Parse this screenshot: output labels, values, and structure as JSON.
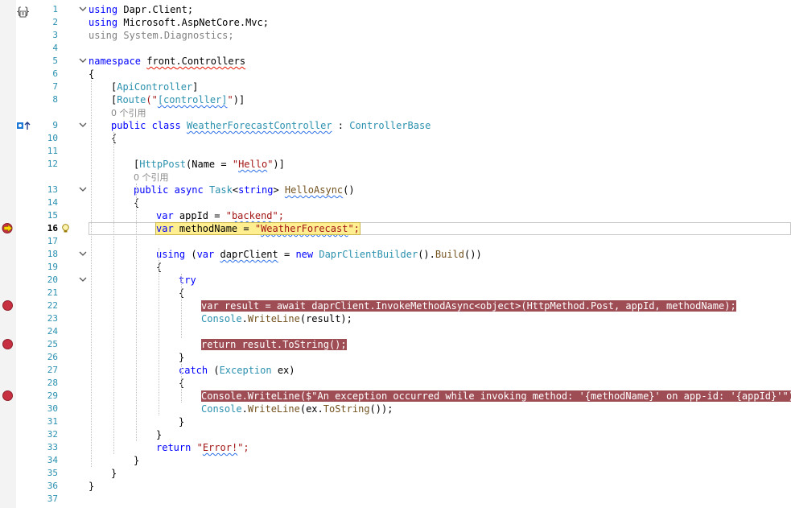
{
  "editor": {
    "lines": [
      {
        "n": "1",
        "fold": "open",
        "tokens": [
          {
            "t": "using",
            "c": "kw"
          },
          {
            "t": " Dapr.Client;",
            "c": "pl"
          }
        ]
      },
      {
        "n": "2",
        "tokens": [
          {
            "t": "using",
            "c": "kw"
          },
          {
            "t": " Microsoft.AspNetCore.Mvc;",
            "c": "pl"
          }
        ]
      },
      {
        "n": "3",
        "tokens": [
          {
            "t": "using System.Diagnostics;",
            "c": "cm"
          }
        ]
      },
      {
        "n": "4",
        "tokens": []
      },
      {
        "n": "5",
        "fold": "open",
        "tokens": [
          {
            "t": "namespace",
            "c": "kw"
          },
          {
            "t": " ",
            "c": "pl"
          },
          {
            "t": "front",
            "c": "pl",
            "s": "squig-red"
          },
          {
            "t": ".Controllers",
            "c": "pl",
            "s": "squig-red"
          }
        ]
      },
      {
        "n": "6",
        "tokens": [
          {
            "t": "{",
            "c": "pl"
          }
        ]
      },
      {
        "n": "7",
        "indent": 1,
        "tokens": [
          {
            "t": "[",
            "c": "pl"
          },
          {
            "t": "ApiController",
            "c": "ty"
          },
          {
            "t": "]",
            "c": "pl"
          }
        ]
      },
      {
        "n": "8",
        "indent": 1,
        "tokens": [
          {
            "t": "[",
            "c": "pl"
          },
          {
            "t": "Route",
            "c": "ty"
          },
          {
            "t": "(\"",
            "c": "st"
          },
          {
            "t": "[controller]",
            "c": "ty",
            "s": "squig"
          },
          {
            "t": "\"",
            "c": "st"
          },
          {
            "t": ")]",
            "c": "pl"
          }
        ]
      },
      {
        "n": "",
        "indent": 1,
        "lens": "0 个引用"
      },
      {
        "n": "9",
        "fold": "open",
        "indent": 1,
        "tokens": [
          {
            "t": "public",
            "c": "kw"
          },
          {
            "t": " ",
            "c": "pl"
          },
          {
            "t": "class",
            "c": "kw"
          },
          {
            "t": " ",
            "c": "pl"
          },
          {
            "t": "WeatherForecastController",
            "c": "ty",
            "s": "squig"
          },
          {
            "t": " : ",
            "c": "pl"
          },
          {
            "t": "ControllerBase",
            "c": "ty"
          }
        ]
      },
      {
        "n": "10",
        "indent": 1,
        "tokens": [
          {
            "t": "{",
            "c": "pl"
          }
        ]
      },
      {
        "n": "11",
        "tokens": []
      },
      {
        "n": "12",
        "indent": 2,
        "tokens": [
          {
            "t": "[",
            "c": "pl"
          },
          {
            "t": "HttpPost",
            "c": "ty"
          },
          {
            "t": "(Name = ",
            "c": "pl"
          },
          {
            "t": "\"",
            "c": "st"
          },
          {
            "t": "Hello",
            "c": "st",
            "s": "squig"
          },
          {
            "t": "\"",
            "c": "st"
          },
          {
            "t": ")]",
            "c": "pl"
          }
        ]
      },
      {
        "n": "",
        "indent": 2,
        "lens": "0 个引用"
      },
      {
        "n": "13",
        "fold": "open",
        "indent": 2,
        "tokens": [
          {
            "t": "public",
            "c": "kw"
          },
          {
            "t": " ",
            "c": "pl"
          },
          {
            "t": "async",
            "c": "kw"
          },
          {
            "t": " ",
            "c": "pl"
          },
          {
            "t": "Task",
            "c": "ty"
          },
          {
            "t": "<",
            "c": "pl"
          },
          {
            "t": "string",
            "c": "kw"
          },
          {
            "t": "> ",
            "c": "pl"
          },
          {
            "t": "HelloAsync",
            "c": "meth",
            "s": "squig"
          },
          {
            "t": "()",
            "c": "pl"
          }
        ]
      },
      {
        "n": "14",
        "indent": 2,
        "tokens": [
          {
            "t": "{",
            "c": "pl"
          }
        ]
      },
      {
        "n": "15",
        "indent": 3,
        "tokens": [
          {
            "t": "var",
            "c": "kw"
          },
          {
            "t": " appId = ",
            "c": "pl"
          },
          {
            "t": "\"",
            "c": "st"
          },
          {
            "t": "backend",
            "c": "st",
            "s": "squig"
          },
          {
            "t": "\";",
            "c": "st"
          }
        ]
      },
      {
        "n": "16",
        "indent": 3,
        "current": true,
        "tokens": [
          {
            "t": "var",
            "c": "kw"
          },
          {
            "t": " methodName = ",
            "c": "pl"
          },
          {
            "t": "\"",
            "c": "st"
          },
          {
            "t": "WeatherForecast",
            "c": "st",
            "s": "squig"
          },
          {
            "t": "\";",
            "c": "st"
          }
        ]
      },
      {
        "n": "17",
        "tokens": []
      },
      {
        "n": "18",
        "fold": "open",
        "indent": 3,
        "tokens": [
          {
            "t": "using",
            "c": "kw"
          },
          {
            "t": " (",
            "c": "pl"
          },
          {
            "t": "var",
            "c": "kw"
          },
          {
            "t": " ",
            "c": "pl"
          },
          {
            "t": "daprClient",
            "c": "pl",
            "s": "squig"
          },
          {
            "t": " = ",
            "c": "pl"
          },
          {
            "t": "new",
            "c": "kw"
          },
          {
            "t": " ",
            "c": "pl"
          },
          {
            "t": "DaprClientBuilder",
            "c": "ty"
          },
          {
            "t": "().",
            "c": "pl"
          },
          {
            "t": "Build",
            "c": "meth"
          },
          {
            "t": "())",
            "c": "pl"
          }
        ]
      },
      {
        "n": "19",
        "indent": 3,
        "tokens": [
          {
            "t": "{",
            "c": "pl"
          }
        ]
      },
      {
        "n": "20",
        "fold": "open",
        "indent": 4,
        "tokens": [
          {
            "t": "try",
            "c": "kw"
          }
        ]
      },
      {
        "n": "21",
        "indent": 4,
        "tokens": [
          {
            "t": "{",
            "c": "pl"
          }
        ]
      },
      {
        "n": "22",
        "indent": 5,
        "bp": true,
        "tokens": [
          {
            "t": "var result = await daprClient.InvokeMethodAsync<object>(HttpMethod.Post, appId, methodName);",
            "c": "pl"
          }
        ]
      },
      {
        "n": "23",
        "indent": 5,
        "tokens": [
          {
            "t": "Console",
            "c": "ty"
          },
          {
            "t": ".",
            "c": "pl"
          },
          {
            "t": "WriteLine",
            "c": "meth"
          },
          {
            "t": "(result);",
            "c": "pl"
          }
        ]
      },
      {
        "n": "24",
        "tokens": []
      },
      {
        "n": "25",
        "indent": 5,
        "bp": true,
        "tokens": [
          {
            "t": "return result.ToString();",
            "c": "pl"
          }
        ]
      },
      {
        "n": "26",
        "indent": 4,
        "tokens": [
          {
            "t": "}",
            "c": "pl"
          }
        ]
      },
      {
        "n": "27",
        "indent": 4,
        "tokens": [
          {
            "t": "catch",
            "c": "kw"
          },
          {
            "t": " (",
            "c": "pl"
          },
          {
            "t": "Exception",
            "c": "ty"
          },
          {
            "t": " ex)",
            "c": "pl"
          }
        ]
      },
      {
        "n": "28",
        "indent": 4,
        "tokens": [
          {
            "t": "{",
            "c": "pl"
          }
        ]
      },
      {
        "n": "29",
        "indent": 5,
        "bp": true,
        "tokens": [
          {
            "t": "Console.WriteLine($\"An exception occurred while invoking method: '{methodName}' on app-id: '{appId}'\");",
            "c": "pl"
          }
        ]
      },
      {
        "n": "30",
        "indent": 5,
        "tokens": [
          {
            "t": "Console",
            "c": "ty"
          },
          {
            "t": ".",
            "c": "pl"
          },
          {
            "t": "WriteLine",
            "c": "meth"
          },
          {
            "t": "(ex.",
            "c": "pl"
          },
          {
            "t": "ToString",
            "c": "meth"
          },
          {
            "t": "());",
            "c": "pl"
          }
        ]
      },
      {
        "n": "31",
        "indent": 4,
        "tokens": [
          {
            "t": "}",
            "c": "pl"
          }
        ]
      },
      {
        "n": "32",
        "indent": 3,
        "tokens": [
          {
            "t": "}",
            "c": "pl"
          }
        ]
      },
      {
        "n": "33",
        "indent": 3,
        "tokens": [
          {
            "t": "return",
            "c": "kw"
          },
          {
            "t": " ",
            "c": "pl"
          },
          {
            "t": "\"",
            "c": "st"
          },
          {
            "t": "Error!",
            "c": "st",
            "s": "squig"
          },
          {
            "t": "\";",
            "c": "st"
          }
        ]
      },
      {
        "n": "34",
        "indent": 2,
        "tokens": [
          {
            "t": "}",
            "c": "pl"
          }
        ]
      },
      {
        "n": "35",
        "indent": 1,
        "tokens": [
          {
            "t": "}",
            "c": "pl"
          }
        ]
      },
      {
        "n": "36",
        "tokens": [
          {
            "t": "}",
            "c": "pl"
          }
        ]
      },
      {
        "n": "37",
        "tokens": []
      }
    ]
  },
  "icons": {
    "structure": "code-structure-icon",
    "codelens": "class-override-icon",
    "execution": "execution-arrow-icon",
    "breakpoint": "breakpoint-icon",
    "quick_actions": "lightbulb-icon"
  },
  "colors": {
    "keyword": "#0000ff",
    "type": "#2b91af",
    "string": "#a31515",
    "breakpoint_bg": "#9f4d55",
    "current_stmt_bg": "#ffef91",
    "line_number": "#2b91af"
  }
}
